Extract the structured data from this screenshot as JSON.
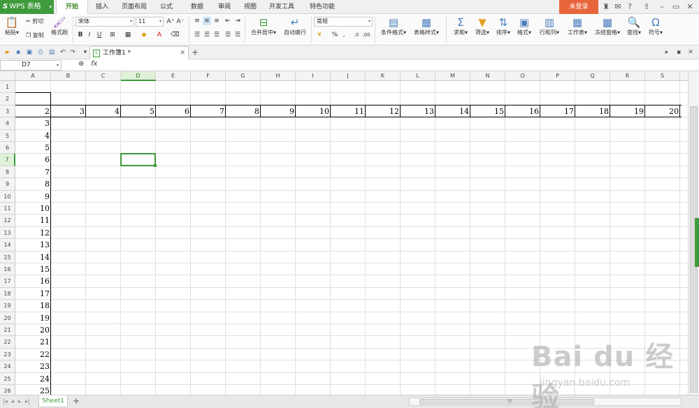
{
  "app": {
    "logo_text": "WPS 表格",
    "login": "未登录"
  },
  "menu": [
    "开始",
    "插入",
    "页面布局",
    "公式",
    "数据",
    "审阅",
    "视图",
    "开发工具",
    "特色功能"
  ],
  "ribbon": {
    "paste": "粘贴",
    "cut": "剪切",
    "copy": "复制",
    "format_painter": "格式刷",
    "font_name": "宋体",
    "font_size": "11",
    "bold": "B",
    "italic": "I",
    "underline": "U",
    "merge_center": "合并居中",
    "wrap_text": "自动换行",
    "number_format": "常规",
    "percent": "%",
    "conditional_format": "条件格式",
    "table_style": "表格样式",
    "sum": "求和",
    "filter": "筛选",
    "sort": "排序",
    "format": "格式",
    "row_col": "行和列",
    "worksheet": "工作表",
    "freeze": "冻结窗格",
    "find": "查找",
    "symbol": "符号"
  },
  "doc_tab": {
    "name": "工作簿1 *"
  },
  "formula_bar": {
    "name_box": "D7",
    "fx": "fx"
  },
  "columns": [
    "A",
    "B",
    "C",
    "D",
    "E",
    "F",
    "G",
    "H",
    "I",
    "J",
    "K",
    "L",
    "M",
    "N",
    "O",
    "P",
    "Q",
    "R",
    "S"
  ],
  "rows": [
    "1",
    "2",
    "3",
    "4",
    "5",
    "6",
    "7",
    "8",
    "9",
    "10",
    "11",
    "12",
    "13",
    "14",
    "15",
    "16",
    "17",
    "18",
    "19",
    "20",
    "21",
    "22",
    "23",
    "24",
    "25",
    "26"
  ],
  "row3_values": [
    "2",
    "3",
    "4",
    "5",
    "6",
    "7",
    "8",
    "9",
    "10",
    "11",
    "12",
    "13",
    "14",
    "15",
    "16",
    "17",
    "18",
    "19",
    "20"
  ],
  "colA_values": [
    "3",
    "4",
    "5",
    "6",
    "7",
    "8",
    "9",
    "10",
    "11",
    "12",
    "13",
    "14",
    "15",
    "16",
    "17",
    "18",
    "19",
    "20",
    "21",
    "22",
    "23",
    "24",
    "25"
  ],
  "selected": {
    "col": "D",
    "row": "7"
  },
  "sheet_tab": "Sheet1",
  "add_sheet": "+",
  "hscroll_mid": "III",
  "watermark": {
    "logo": "Bai du 经验",
    "url": "jingyan.baidu.com"
  }
}
